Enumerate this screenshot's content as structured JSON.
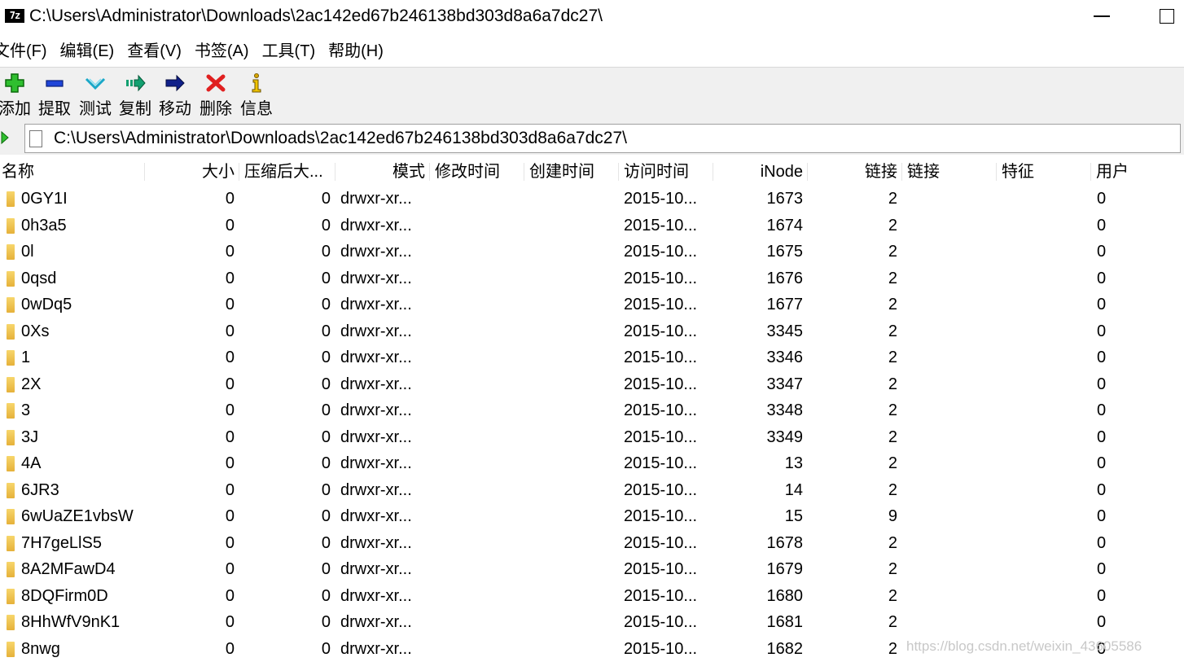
{
  "window": {
    "app_icon_text": "7z",
    "title": "C:\\Users\\Administrator\\Downloads\\2ac142ed67b246138bd303d8a6a7dc27\\"
  },
  "menu": [
    "文件(F)",
    "编辑(E)",
    "查看(V)",
    "书签(A)",
    "工具(T)",
    "帮助(H)"
  ],
  "toolbar": [
    {
      "label": "添加",
      "icon": "add-icon",
      "color": "#22aa22"
    },
    {
      "label": "提取",
      "icon": "extract-icon",
      "color": "#1a3fd0"
    },
    {
      "label": "测试",
      "icon": "test-icon",
      "color": "#1aa8c8"
    },
    {
      "label": "复制",
      "icon": "copy-icon",
      "color": "#12a070"
    },
    {
      "label": "移动",
      "icon": "move-icon",
      "color": "#10208a"
    },
    {
      "label": "删除",
      "icon": "delete-icon",
      "color": "#e02020"
    },
    {
      "label": "信息",
      "icon": "info-icon",
      "color": "#d6a400"
    }
  ],
  "address": {
    "path": "C:\\Users\\Administrator\\Downloads\\2ac142ed67b246138bd303d8a6a7dc27\\"
  },
  "columns": [
    "名称",
    "大小",
    "压缩后大...",
    "模式",
    "修改时间",
    "创建时间",
    "访问时间",
    "iNode",
    "链接",
    "链接",
    "特征",
    "用户"
  ],
  "rows": [
    {
      "name": "0GY1I",
      "size": "0",
      "packed": "0",
      "mode": "drwxr-xr...",
      "accessed": "2015-10...",
      "inode": "1673",
      "links": "2",
      "user": "0"
    },
    {
      "name": "0h3a5",
      "size": "0",
      "packed": "0",
      "mode": "drwxr-xr...",
      "accessed": "2015-10...",
      "inode": "1674",
      "links": "2",
      "user": "0"
    },
    {
      "name": "0l",
      "size": "0",
      "packed": "0",
      "mode": "drwxr-xr...",
      "accessed": "2015-10...",
      "inode": "1675",
      "links": "2",
      "user": "0"
    },
    {
      "name": "0qsd",
      "size": "0",
      "packed": "0",
      "mode": "drwxr-xr...",
      "accessed": "2015-10...",
      "inode": "1676",
      "links": "2",
      "user": "0"
    },
    {
      "name": "0wDq5",
      "size": "0",
      "packed": "0",
      "mode": "drwxr-xr...",
      "accessed": "2015-10...",
      "inode": "1677",
      "links": "2",
      "user": "0"
    },
    {
      "name": "0Xs",
      "size": "0",
      "packed": "0",
      "mode": "drwxr-xr...",
      "accessed": "2015-10...",
      "inode": "3345",
      "links": "2",
      "user": "0"
    },
    {
      "name": "1",
      "size": "0",
      "packed": "0",
      "mode": "drwxr-xr...",
      "accessed": "2015-10...",
      "inode": "3346",
      "links": "2",
      "user": "0"
    },
    {
      "name": "2X",
      "size": "0",
      "packed": "0",
      "mode": "drwxr-xr...",
      "accessed": "2015-10...",
      "inode": "3347",
      "links": "2",
      "user": "0"
    },
    {
      "name": "3",
      "size": "0",
      "packed": "0",
      "mode": "drwxr-xr...",
      "accessed": "2015-10...",
      "inode": "3348",
      "links": "2",
      "user": "0"
    },
    {
      "name": "3J",
      "size": "0",
      "packed": "0",
      "mode": "drwxr-xr...",
      "accessed": "2015-10...",
      "inode": "3349",
      "links": "2",
      "user": "0"
    },
    {
      "name": "4A",
      "size": "0",
      "packed": "0",
      "mode": "drwxr-xr...",
      "accessed": "2015-10...",
      "inode": "13",
      "links": "2",
      "user": "0"
    },
    {
      "name": "6JR3",
      "size": "0",
      "packed": "0",
      "mode": "drwxr-xr...",
      "accessed": "2015-10...",
      "inode": "14",
      "links": "2",
      "user": "0"
    },
    {
      "name": "6wUaZE1vbsW",
      "size": "0",
      "packed": "0",
      "mode": "drwxr-xr...",
      "accessed": "2015-10...",
      "inode": "15",
      "links": "9",
      "user": "0"
    },
    {
      "name": "7H7geLlS5",
      "size": "0",
      "packed": "0",
      "mode": "drwxr-xr...",
      "accessed": "2015-10...",
      "inode": "1678",
      "links": "2",
      "user": "0"
    },
    {
      "name": "8A2MFawD4",
      "size": "0",
      "packed": "0",
      "mode": "drwxr-xr...",
      "accessed": "2015-10...",
      "inode": "1679",
      "links": "2",
      "user": "0"
    },
    {
      "name": "8DQFirm0D",
      "size": "0",
      "packed": "0",
      "mode": "drwxr-xr...",
      "accessed": "2015-10...",
      "inode": "1680",
      "links": "2",
      "user": "0"
    },
    {
      "name": "8HhWfV9nK1",
      "size": "0",
      "packed": "0",
      "mode": "drwxr-xr...",
      "accessed": "2015-10...",
      "inode": "1681",
      "links": "2",
      "user": "0"
    },
    {
      "name": "8nwg",
      "size": "0",
      "packed": "0",
      "mode": "drwxr-xr...",
      "accessed": "2015-10...",
      "inode": "1682",
      "links": "2",
      "user": "0"
    }
  ],
  "watermark": "https://blog.csdn.net/weixin_43605586"
}
